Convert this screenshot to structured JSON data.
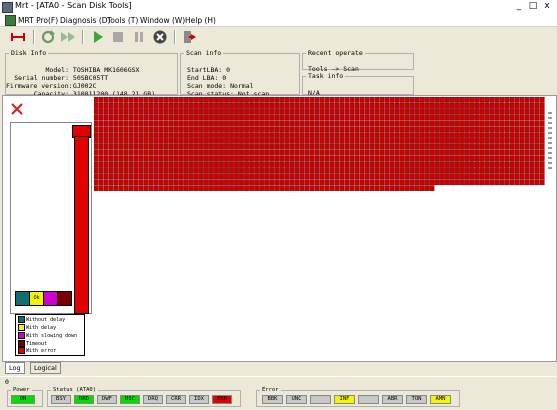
{
  "window": {
    "title": "Mrt - [ATA0 - Scan Disk Tools]",
    "controls": [
      "_",
      "□",
      "x"
    ]
  },
  "menu": [
    {
      "label": "MRT Pro(F)"
    },
    {
      "label": "Diagnosis (D)"
    },
    {
      "label": "Tools (T)"
    },
    {
      "label": "Window (W)"
    },
    {
      "label": "Help (H)"
    }
  ],
  "toolbar": {
    "icons": [
      "disconnect-icon",
      "refresh-icon",
      "fast-forward-icon",
      "play-icon",
      "stop-icon",
      "pause-icon",
      "cancel-icon",
      "exit-icon"
    ]
  },
  "disk_info": {
    "legend": "Disk Info",
    "fields": [
      {
        "label": "Model:",
        "value": "TOSHIBA MK1606GSX"
      },
      {
        "label": "Serial number:",
        "value": "50SBC05TT"
      },
      {
        "label": "Firmware version:",
        "value": "GJ002C"
      },
      {
        "label": "Capacity:",
        "value": "310811200 (148.21 GB)"
      }
    ]
  },
  "scan_info": {
    "legend": "Scan info",
    "fields": [
      {
        "label": "StartLBA:",
        "value": "0"
      },
      {
        "label": "End LBA:",
        "value": "0"
      },
      {
        "label": "Scan mode:",
        "value": "Normal"
      },
      {
        "label": "Scan status:",
        "value": "Not scan"
      }
    ]
  },
  "recent_operate": {
    "legend": "Recent operate",
    "value": "Tools -> Scan"
  },
  "task_info": {
    "legend": "Task info",
    "value": "N/A"
  },
  "bars": {
    "swatches": [
      {
        "label": "",
        "color": "#0f6e6e"
      },
      {
        "label": "0k",
        "color": "#f5f500"
      },
      {
        "label": "",
        "color": "#d000d0"
      },
      {
        "label": "",
        "color": "#7a0000"
      }
    ],
    "error_column_color": "#e00000",
    "error_level": 1.0
  },
  "legend": [
    {
      "label": "Without delay",
      "color": "#0f6e6e"
    },
    {
      "label": "With delay",
      "color": "#f5f500"
    },
    {
      "label": "With slowing down",
      "color": "#d000d0"
    },
    {
      "label": "Timeout",
      "color": "#7a0000"
    },
    {
      "label": "With error",
      "color": "#e00000"
    }
  ],
  "scan_grid": {
    "block_color": "#cc0000",
    "full_rows": 15,
    "partial_row_fraction": 0.76,
    "columns": 90
  },
  "tabs": [
    {
      "label": "Log"
    },
    {
      "label": "Logical scan"
    }
  ],
  "status_counter": "0",
  "power": {
    "legend": "Power",
    "value": "ON",
    "color": "#00e000"
  },
  "status": {
    "legend": "Status (ATA0)",
    "tags": [
      {
        "label": "BSY",
        "color": "#c8c8c8"
      },
      {
        "label": "DRD",
        "color": "#00e000"
      },
      {
        "label": "DWF",
        "color": "#c8c8c8"
      },
      {
        "label": "DSC",
        "color": "#00e000"
      },
      {
        "label": "DRQ",
        "color": "#c8c8c8"
      },
      {
        "label": "CRR",
        "color": "#c8c8c8"
      },
      {
        "label": "IDX",
        "color": "#c8c8c8"
      },
      {
        "label": "ERR",
        "color": "#e00000"
      }
    ]
  },
  "error": {
    "legend": "Error",
    "tags": [
      {
        "label": "BBK",
        "color": "#c8c8c8"
      },
      {
        "label": "UNC",
        "color": "#c8c8c8"
      },
      {
        "label": "",
        "color": "#c8c8c8"
      },
      {
        "label": "INF",
        "color": "#f5f500"
      },
      {
        "label": "",
        "color": "#c8c8c8"
      },
      {
        "label": "ABR",
        "color": "#c8c8c8"
      },
      {
        "label": "TON",
        "color": "#c8c8c8"
      },
      {
        "label": "AMN",
        "color": "#f5f500"
      }
    ]
  }
}
